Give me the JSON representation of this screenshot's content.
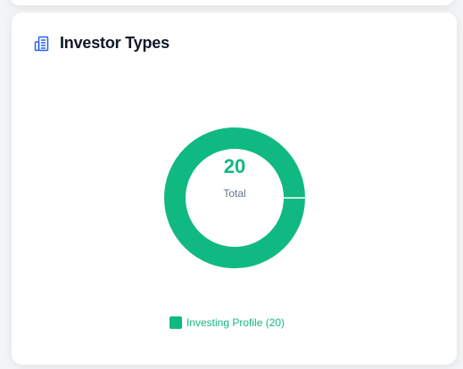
{
  "card": {
    "title": "Investor Types",
    "icon": "building-icon"
  },
  "colors": {
    "accent": "#10b981",
    "icon": "#2563eb"
  },
  "chart_data": {
    "type": "pie",
    "variant": "donut",
    "title": "",
    "center_value": "20",
    "center_label": "Total",
    "categories": [
      "Investing Profile"
    ],
    "values": [
      20
    ],
    "legend": [
      "Investing Profile (20)"
    ],
    "legend_position": "bottom"
  }
}
